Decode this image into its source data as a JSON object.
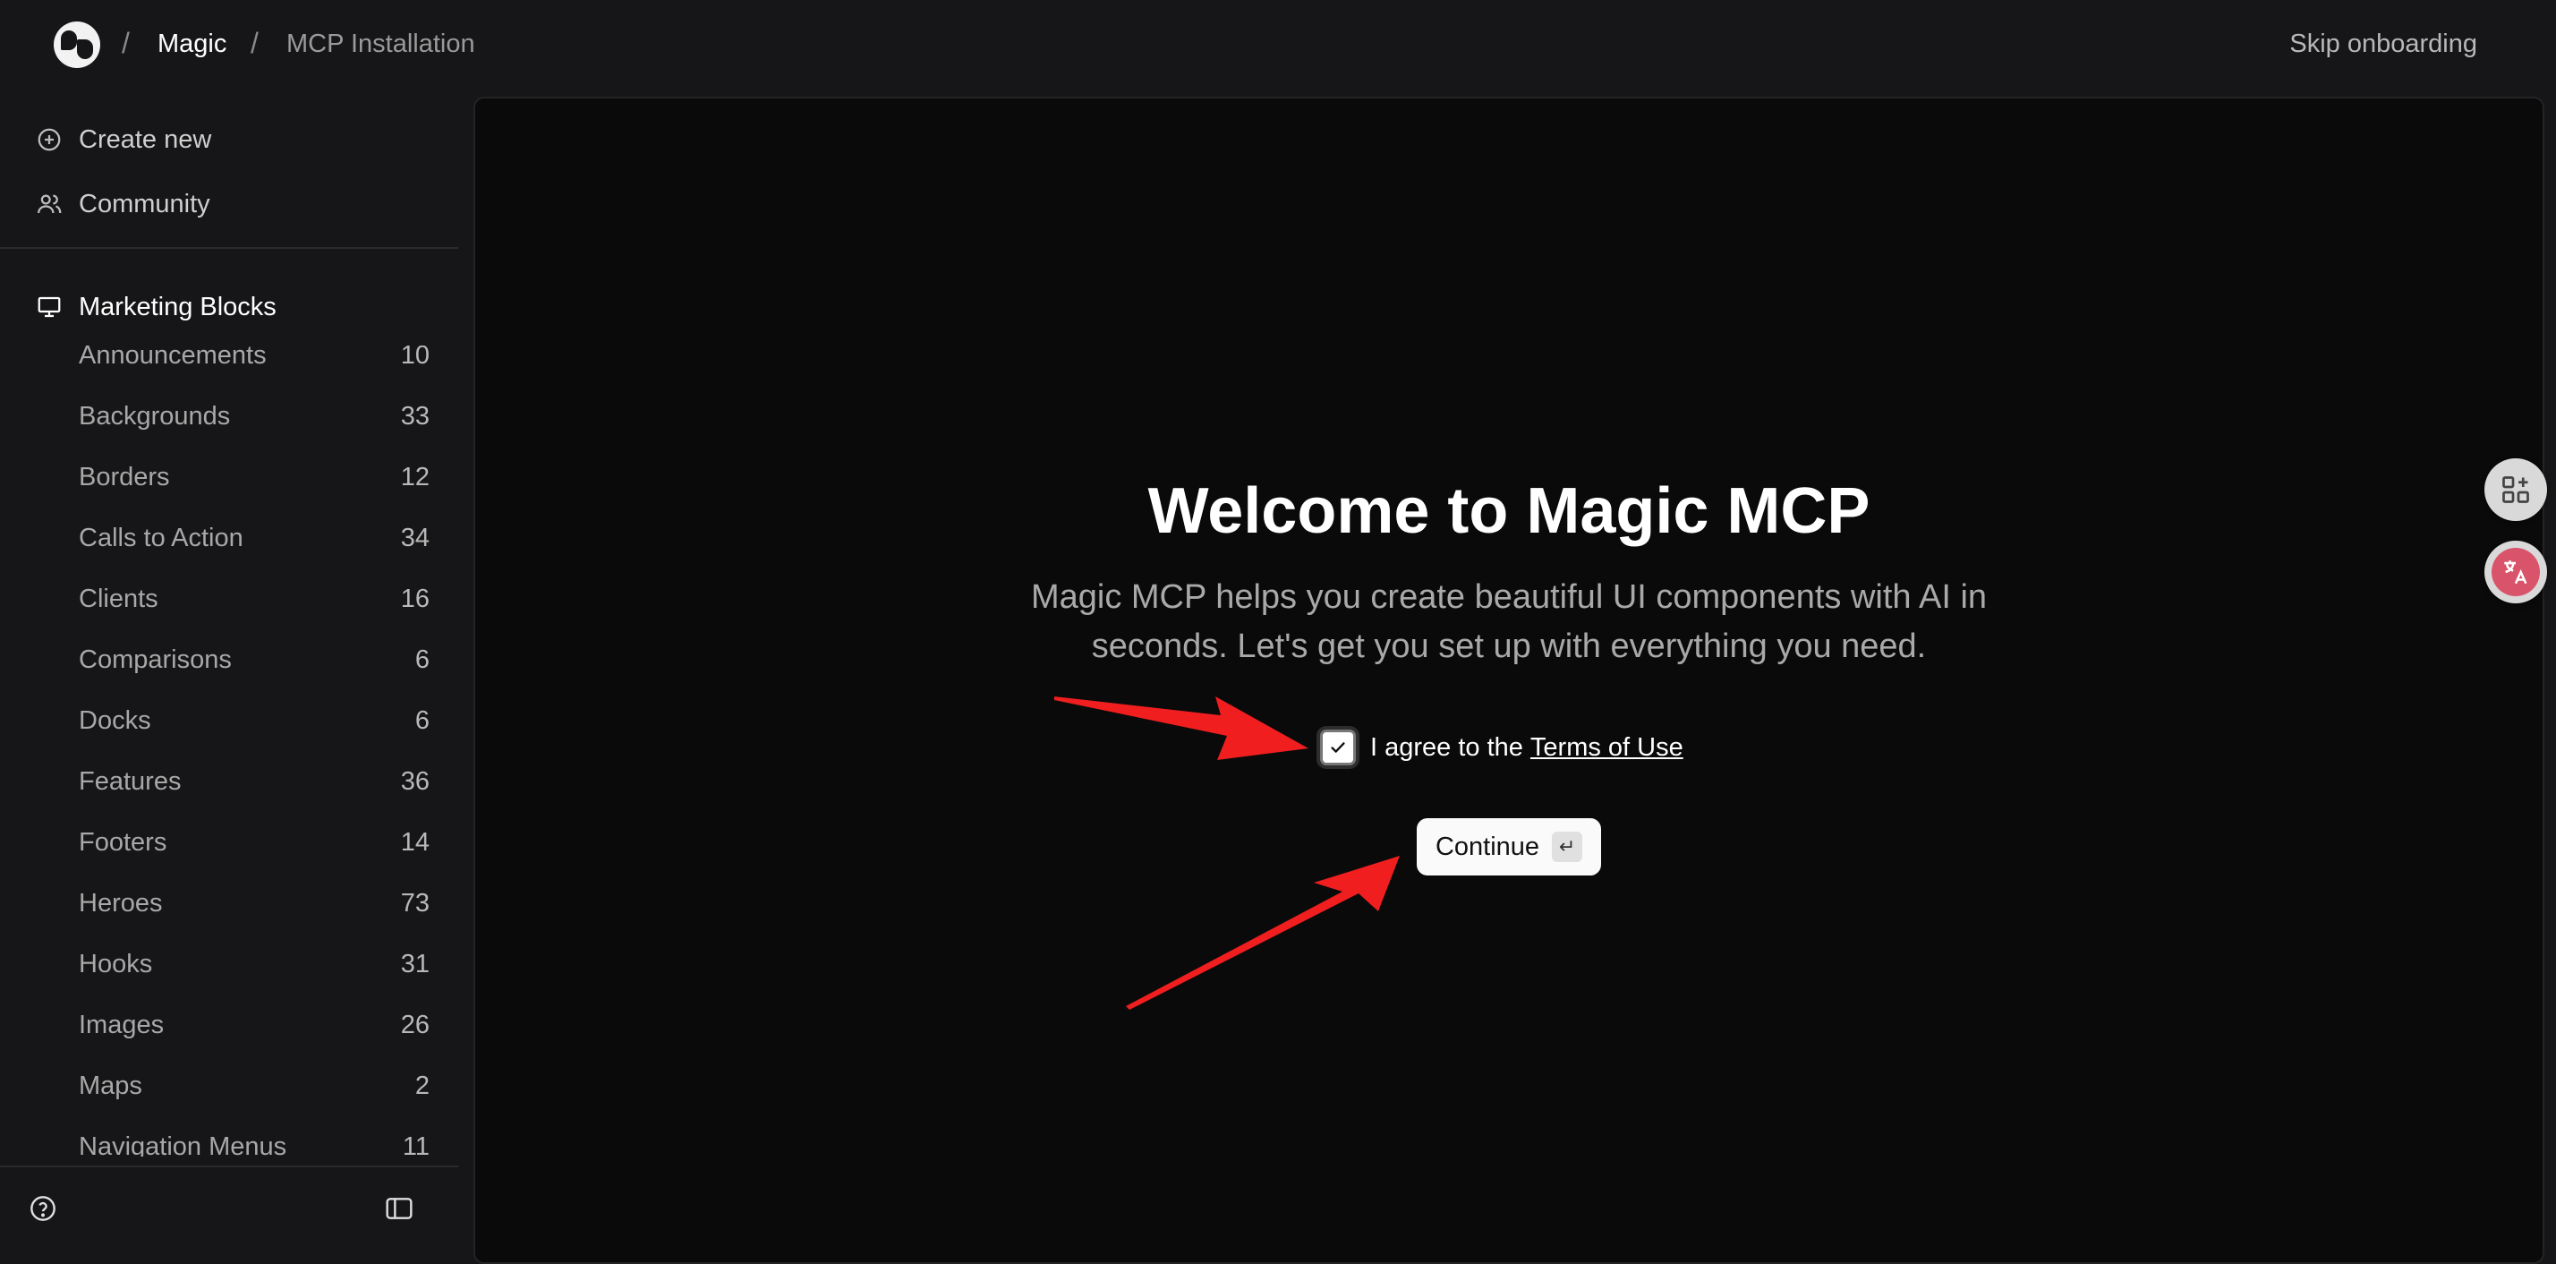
{
  "header": {
    "breadcrumb": [
      "Magic",
      "MCP Installation"
    ],
    "separator": "/",
    "skip_label": "Skip onboarding"
  },
  "sidebar": {
    "top_items": [
      {
        "label": "Create new",
        "icon": "plus-circle-icon"
      },
      {
        "label": "Community",
        "icon": "users-icon"
      }
    ],
    "section": {
      "label": "Marketing Blocks",
      "icon": "presentation-icon"
    },
    "categories": [
      {
        "label": "Announcements",
        "count": "10"
      },
      {
        "label": "Backgrounds",
        "count": "33"
      },
      {
        "label": "Borders",
        "count": "12"
      },
      {
        "label": "Calls to Action",
        "count": "34"
      },
      {
        "label": "Clients",
        "count": "16"
      },
      {
        "label": "Comparisons",
        "count": "6"
      },
      {
        "label": "Docks",
        "count": "6"
      },
      {
        "label": "Features",
        "count": "36"
      },
      {
        "label": "Footers",
        "count": "14"
      },
      {
        "label": "Heroes",
        "count": "73"
      },
      {
        "label": "Hooks",
        "count": "31"
      },
      {
        "label": "Images",
        "count": "26"
      },
      {
        "label": "Maps",
        "count": "2"
      },
      {
        "label": "Navigation Menus",
        "count": "11"
      }
    ]
  },
  "main": {
    "title": "Welcome to Magic MCP",
    "subtitle_line1": "Magic MCP helps you create beautiful UI components with AI in",
    "subtitle_line2": "seconds. Let's get you set up with everything you need.",
    "agree_text": "I agree to the",
    "terms_link": "Terms of Use",
    "checkbox_checked": true,
    "continue_label": "Continue",
    "continue_key": "↵"
  },
  "floating": {
    "top_icon": "add-widget-icon",
    "bottom_icon": "translate-icon"
  },
  "colors": {
    "background": "#161618",
    "panel": "#0a0a0b",
    "arrow": "#f01e1e",
    "translate_badge": "#d9536b"
  }
}
